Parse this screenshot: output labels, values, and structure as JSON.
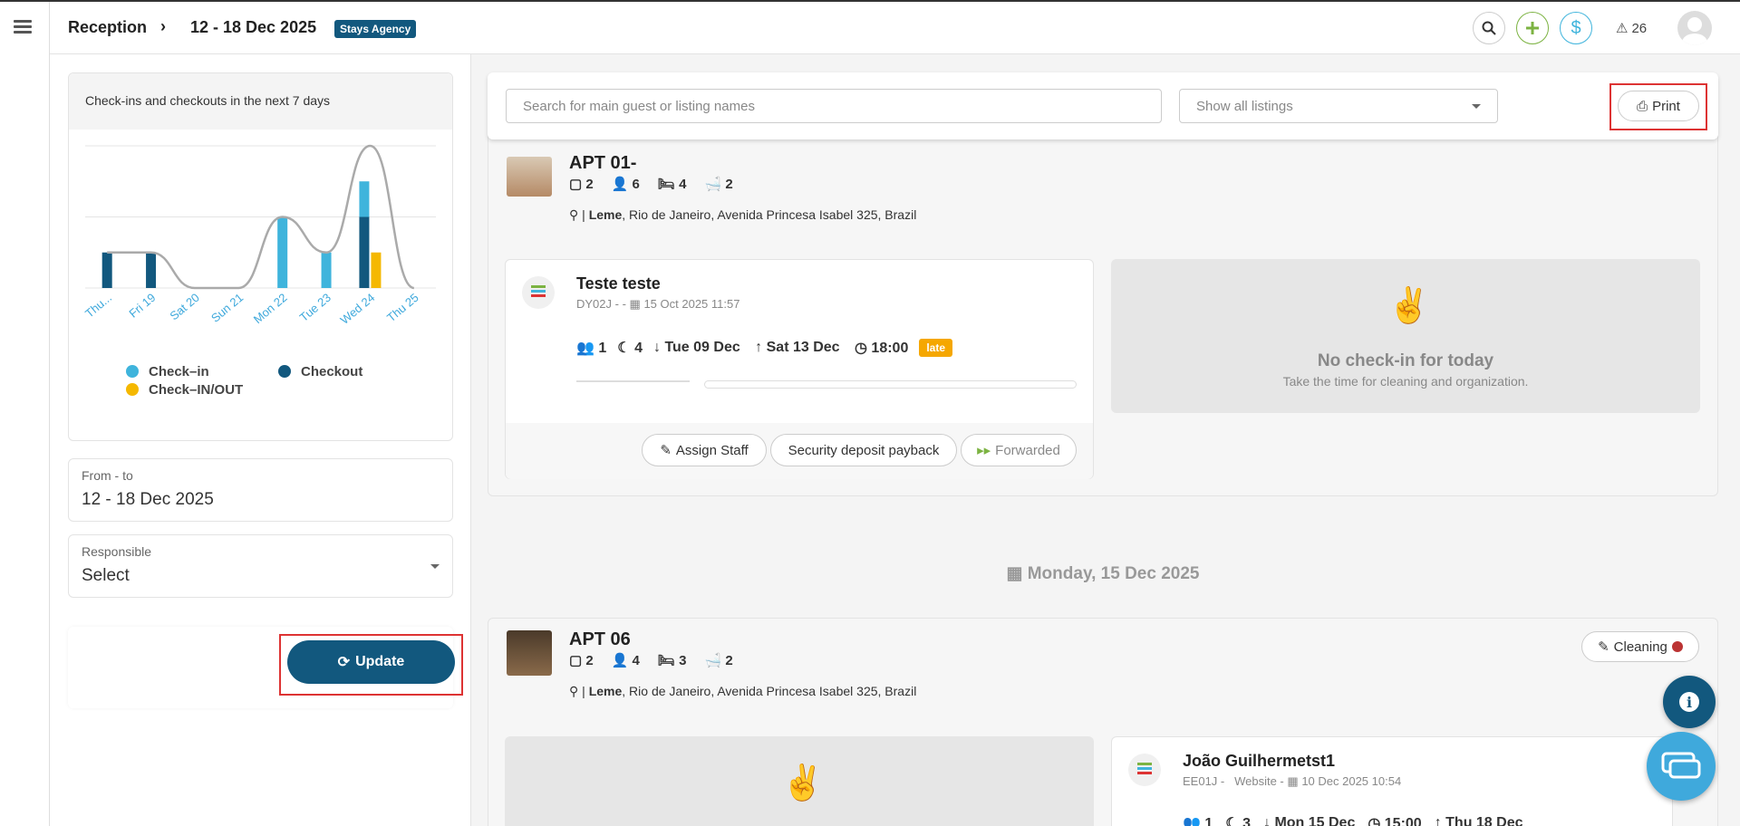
{
  "header": {
    "page": "Reception",
    "date_range": "12 - 18 Dec 2025",
    "agency": "Stays Agency",
    "alerts_count": "26"
  },
  "sidebar": {
    "chart_title": "Check-ins and checkouts in the next 7 days",
    "from_to_label": "From - to",
    "from_to_value": "12 - 18 Dec 2025",
    "responsible_label": "Responsible",
    "responsible_value": "Select",
    "update_label": "Update"
  },
  "chart_data": {
    "type": "bar",
    "categories": [
      "Thu...",
      "Fri 19",
      "Sat 20",
      "Sun 21",
      "Mon 22",
      "Tue 23",
      "Wed 24",
      "Thu 25"
    ],
    "series": [
      {
        "name": "Check–in",
        "color": "#3fb4dc",
        "values": [
          0,
          0,
          0,
          0,
          2,
          1,
          1,
          0
        ]
      },
      {
        "name": "Checkout",
        "color": "#12587e",
        "values": [
          1,
          1,
          0,
          0,
          0,
          0,
          2,
          0
        ]
      },
      {
        "name": "Check–IN/OUT",
        "color": "#f5b800",
        "values": [
          0,
          0,
          0,
          0,
          0,
          0,
          1,
          0
        ]
      }
    ],
    "stacked": true,
    "ylim": [
      0,
      4
    ],
    "grid": true,
    "legend": "bottom"
  },
  "toolbar": {
    "search_placeholder": "Search for main guest or listing names",
    "listing_filter": "Show all listings",
    "print_label": "Print"
  },
  "listings": [
    {
      "name": "APT 01-",
      "stats": [
        "2",
        "6",
        "4",
        "2"
      ],
      "neighborhood": "Leme",
      "address": ", Rio de Janeiro, Avenida Princesa Isabel 325, Brazil",
      "reservation": {
        "guest": "Teste teste",
        "code": "DY02J - -",
        "created": "15 Oct 2025 11:57",
        "guests": "1",
        "nights": "4",
        "checkin": "Tue 09 Dec",
        "checkout": "Sat 13 Dec",
        "time": "18:00",
        "status": "late",
        "actions": [
          "Assign Staff",
          "Security deposit payback",
          "Forwarded"
        ]
      },
      "empty_title": "No check-in for today",
      "empty_sub": "Take the time for cleaning and organization."
    },
    {
      "date_header": "Monday, 15 Dec 2025",
      "name": "APT 06",
      "stats": [
        "2",
        "4",
        "3",
        "2"
      ],
      "neighborhood": "Leme",
      "address": ", Rio de Janeiro, Avenida Princesa Isabel 325, Brazil",
      "cleaning_label": "Cleaning",
      "reservation": {
        "guest": "João Guilhermetst1",
        "code": "EE01J -",
        "source": "Website -",
        "created": "10 Dec 2025 10:54",
        "guests": "1",
        "nights": "3",
        "checkin": "Mon 15 Dec",
        "time": "15:00",
        "checkout": "Thu 18 Dec"
      }
    }
  ]
}
